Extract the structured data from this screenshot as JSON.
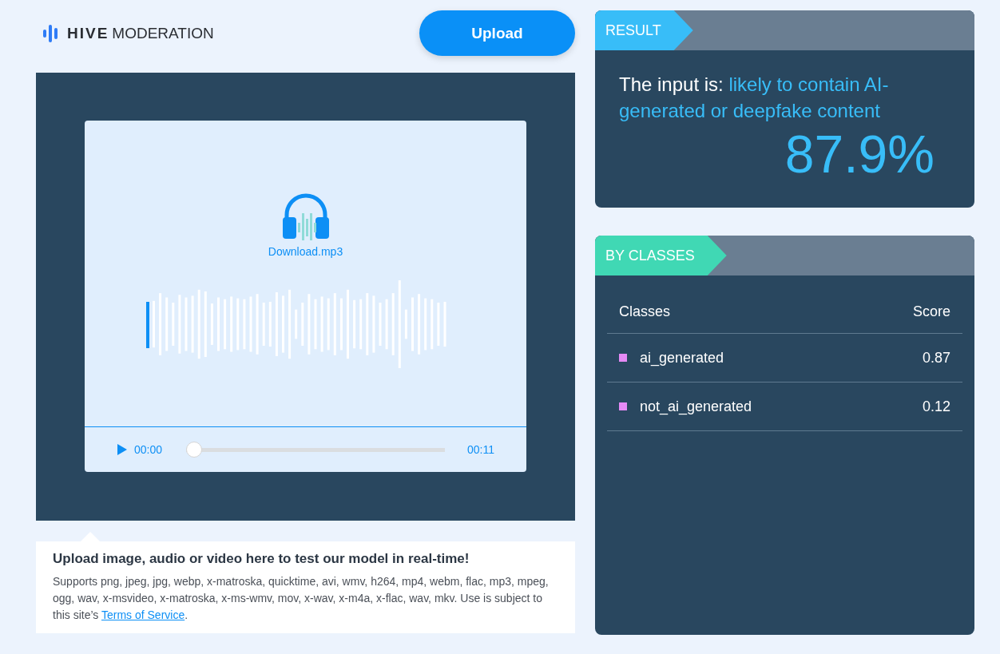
{
  "header": {
    "logo_bold": "HIVE",
    "logo_light": "MODERATION",
    "upload_button": "Upload"
  },
  "media": {
    "file_name": "Download.mp3",
    "player": {
      "current_time": "00:00",
      "duration": "00:11",
      "level": 0
    }
  },
  "caption": {
    "title": "Upload image, audio or video here to test our model in real-time!",
    "text_before": "Supports png, jpeg, jpg, webp, x-matroska, quicktime, avi, wmv, h264, mp4, webm, flac, mp3, mpeg, ogg, wav, x-msvideo, x-matroska, x-ms-wmv, mov, x-wav, x-m4a, x-flac, wav, mkv. Use is subject to this site’s ",
    "link": "Terms of Service",
    "text_after": "."
  },
  "result": {
    "tab": "RESULT",
    "label": "The input is: ",
    "verdict": "likely to contain AI-generated or deepfake content",
    "percentage": "87.9%"
  },
  "by_classes": {
    "tab": "BY CLASSES",
    "columns": [
      "Classes",
      "Score"
    ],
    "rows": [
      {
        "name": "ai_generated",
        "score": "0.87"
      },
      {
        "name": "not_ai_generated",
        "score": "0.12"
      }
    ]
  }
}
